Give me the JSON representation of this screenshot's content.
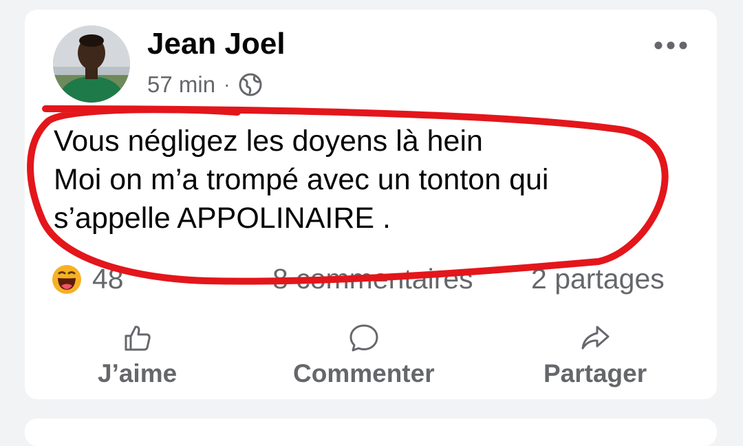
{
  "post": {
    "author": "Jean Joel",
    "time": "57 min",
    "separator": "·",
    "privacy_icon": "globe-icon",
    "more_icon": "more-horizontal-icon",
    "text_lines": [
      "Vous négligez les doyens là hein",
      "Moi on m’a trompé avec un tonton qui",
      "s’appelle APPOLINAIRE ."
    ]
  },
  "stats": {
    "reaction_icon": "haha-reaction-icon",
    "reaction_count": "48",
    "comments": "8 commentaires",
    "shares": "2 partages"
  },
  "actions": {
    "like": "J’aime",
    "comment": "Commenter",
    "share": "Partager"
  },
  "colors": {
    "annotation": "#e3161b",
    "secondary_text": "#65676b",
    "primary_text": "#050505",
    "reaction_yellow": "#f7b125"
  }
}
